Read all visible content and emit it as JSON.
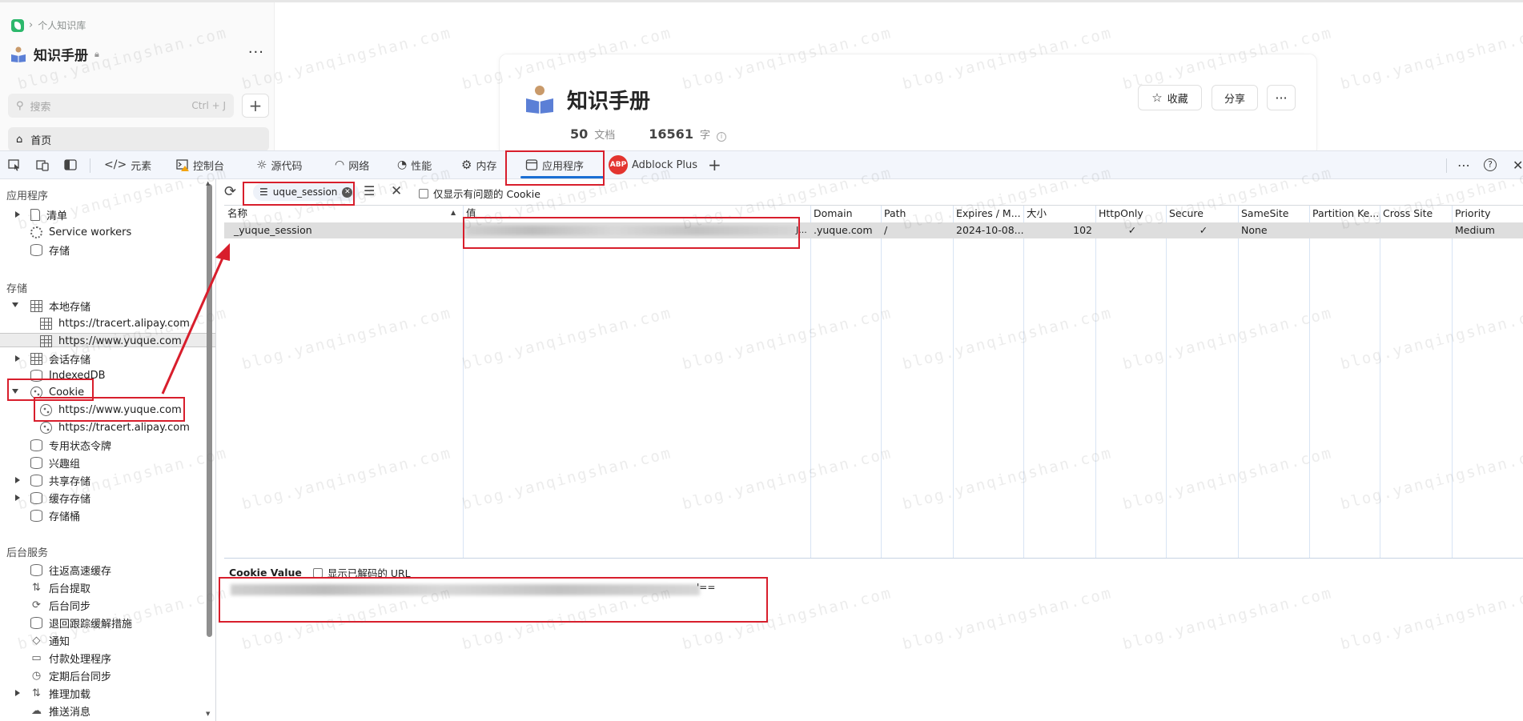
{
  "yuque": {
    "breadcrumb": "个人知识库",
    "kb_title": "知识手册",
    "search_placeholder": "搜索",
    "search_shortcut": "Ctrl + J",
    "nav_home": "首页",
    "main_title": "知识手册",
    "doc_count": "50",
    "doc_label": "文档",
    "word_count": "16561",
    "word_label": "字",
    "collect_label": "收藏",
    "share_label": "分享"
  },
  "devtools": {
    "tabs": {
      "elements": "元素",
      "console": "控制台",
      "sources": "源代码",
      "network": "网络",
      "performance": "性能",
      "memory": "内存",
      "application": "应用程序",
      "adblock": "Adblock Plus"
    },
    "abp_badge": "ABP",
    "sidebar": {
      "section_app": "应用程序",
      "manifest": "清单",
      "service_workers": "Service workers",
      "storage_overview": "存储",
      "section_storage": "存储",
      "local_storage": "本地存储",
      "local_tracert": "https://tracert.alipay.com",
      "local_yuque": "https://www.yuque.com",
      "session_storage": "会话存储",
      "indexeddb": "IndexedDB",
      "cookie": "Cookie",
      "cookie_yuque": "https://www.yuque.com",
      "cookie_tracert": "https://tracert.alipay.com",
      "private_state_tokens": "专用状态令牌",
      "interest_groups": "兴趣组",
      "shared_storage": "共享存储",
      "cache_storage": "缓存存储",
      "storage_buckets": "存储桶",
      "section_background": "后台服务",
      "bfcache": "往返高速缓存",
      "background_fetch": "后台提取",
      "background_sync": "后台同步",
      "bounce_tracking": "退回跟踪缓解措施",
      "notifications": "通知",
      "payment_handler": "付款处理程序",
      "periodic_sync": "定期后台同步",
      "speculative_loads": "推理加载",
      "push_messaging": "推送消息"
    },
    "filter": {
      "value": "uque_session",
      "only_issues_label": "仅显示有问题的 Cookie"
    },
    "table": {
      "headers": [
        "名称",
        "值",
        "Domain",
        "Path",
        "Expires / M...",
        "大小",
        "HttpOnly",
        "Secure",
        "SameSite",
        "Partition Ke...",
        "Cross Site",
        "Priority"
      ],
      "row": {
        "name": "_yuque_session",
        "value_tail": "J...",
        "domain": ".yuque.com",
        "path": "/",
        "expires": "2024-10-08...",
        "size": "102",
        "httponly": "✓",
        "secure": "✓",
        "samesite": "None",
        "priority": "Medium"
      }
    },
    "cookie_value": {
      "title": "Cookie Value",
      "show_decoded_label": "显示已解码的 URL",
      "value_tail": "'=="
    }
  },
  "watermark": "blog.yanqingshan.com",
  "colors": {
    "annotation_red": "#d81e2c",
    "active_tab_blue": "#1a6fd4",
    "abp_red": "#e3342f",
    "yuque_green": "#2db86c"
  }
}
